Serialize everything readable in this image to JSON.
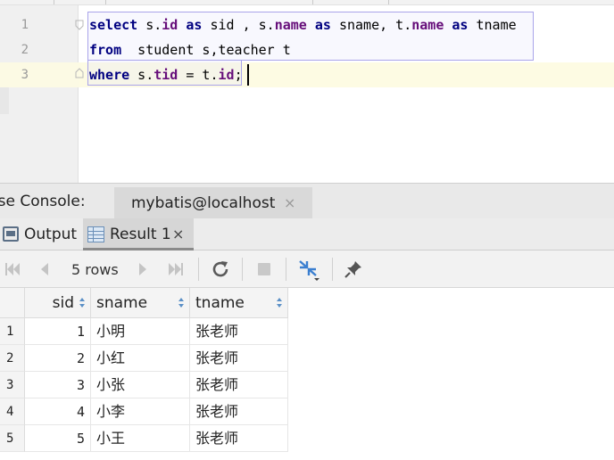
{
  "editor": {
    "line_numbers": [
      "1",
      "2",
      "3"
    ],
    "lines": [
      [
        {
          "t": "select",
          "c": "kw"
        },
        {
          "t": " s.",
          "c": ""
        },
        {
          "t": "id",
          "c": "fld"
        },
        {
          "t": " ",
          "c": ""
        },
        {
          "t": "as",
          "c": "kw"
        },
        {
          "t": " sid , s.",
          "c": ""
        },
        {
          "t": "name",
          "c": "fld"
        },
        {
          "t": " ",
          "c": ""
        },
        {
          "t": "as",
          "c": "kw"
        },
        {
          "t": " sname, t.",
          "c": ""
        },
        {
          "t": "name",
          "c": "fld"
        },
        {
          "t": " ",
          "c": ""
        },
        {
          "t": "as",
          "c": "kw"
        },
        {
          "t": " tname",
          "c": ""
        }
      ],
      [
        {
          "t": "from",
          "c": "kw"
        },
        {
          "t": "  student s,teacher t",
          "c": ""
        }
      ],
      [
        {
          "t": "where",
          "c": "kw"
        },
        {
          "t": " s.",
          "c": ""
        },
        {
          "t": "tid",
          "c": "fld"
        },
        {
          "t": " = t.",
          "c": ""
        },
        {
          "t": "id",
          "c": "fld"
        },
        {
          "t": ";",
          "c": ""
        }
      ]
    ]
  },
  "console": {
    "label": "abase Console:",
    "tab_title": "mybatis@localhost",
    "tab_close": "×"
  },
  "result_tabs": {
    "output_label": "Output",
    "result_label": "Result 1",
    "result_close": "×"
  },
  "toolbar": {
    "rows_label": "5 rows"
  },
  "grid": {
    "columns": [
      "sid",
      "sname",
      "tname"
    ],
    "rows": [
      [
        "1",
        "1",
        "小明",
        "张老师"
      ],
      [
        "2",
        "2",
        "小红",
        "张老师"
      ],
      [
        "3",
        "3",
        "小张",
        "张老师"
      ],
      [
        "4",
        "4",
        "小李",
        "张老师"
      ],
      [
        "5",
        "5",
        "小王",
        "张老师"
      ]
    ]
  },
  "colors": {
    "keyword": "#000080",
    "field": "#660e7a",
    "selection_border": "#a9a4ea",
    "current_line": "#fdfbe3",
    "sort_arrow": "#5a8fc6"
  }
}
